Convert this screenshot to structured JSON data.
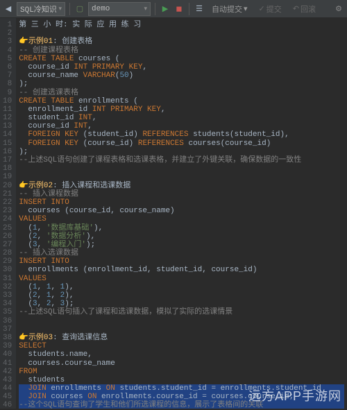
{
  "toolbar": {
    "left_dropdown": "SQL冷知识",
    "schema_dropdown": "demo",
    "autocommit_label": "自动提交",
    "submit_label": "提交",
    "rollback_label": "回滚"
  },
  "watermark": "远方APP手游网",
  "code_lines": [
    {
      "n": 1,
      "html": "第 三 小 时: 实 际 应 用 练 习"
    },
    {
      "n": 2,
      "html": ""
    },
    {
      "n": 3,
      "html": "<span class='c-emoji'>👉示例01</span>: 创建表格"
    },
    {
      "n": 4,
      "html": "<span class='c-comment'>-- 创建课程表格</span>"
    },
    {
      "n": 5,
      "html": "<span class='c-kw'>CREATE TABLE</span> courses ("
    },
    {
      "n": 6,
      "html": "  course_id <span class='c-type'>INT PRIMARY KEY</span>,"
    },
    {
      "n": 7,
      "html": "  course_name <span class='c-type'>VARCHAR</span>(<span class='c-num'>50</span>)"
    },
    {
      "n": 8,
      "html": ");"
    },
    {
      "n": 9,
      "html": "<span class='c-comment'>-- 创建选课表格</span>"
    },
    {
      "n": 10,
      "html": "<span class='c-kw'>CREATE TABLE</span> enrollments ("
    },
    {
      "n": 11,
      "html": "  enrollment_id <span class='c-type'>INT PRIMARY KEY</span>,"
    },
    {
      "n": 12,
      "html": "  student_id <span class='c-type'>INT</span>,"
    },
    {
      "n": 13,
      "html": "  course_id <span class='c-type'>INT</span>,"
    },
    {
      "n": 14,
      "html": "  <span class='c-kw'>FOREIGN KEY</span> (student_id) <span class='c-kw'>REFERENCES</span> students(student_id),"
    },
    {
      "n": 15,
      "html": "  <span class='c-kw'>FOREIGN KEY</span> (course_id) <span class='c-kw'>REFERENCES</span> courses(course_id)"
    },
    {
      "n": 16,
      "html": ");"
    },
    {
      "n": 17,
      "html": "<span class='c-comment'>--上述SQL语句创建了课程表格和选课表格，并建立了外键关联，确保数据的一致性</span>"
    },
    {
      "n": 18,
      "html": ""
    },
    {
      "n": 19,
      "html": ""
    },
    {
      "n": 20,
      "html": "<span class='c-emoji'>👉示例02</span>: 插入课程和选课数据"
    },
    {
      "n": 21,
      "html": "<span class='c-comment'>-- 插入课程数据</span>"
    },
    {
      "n": 22,
      "html": "<span class='c-kw'>INSERT INTO</span>"
    },
    {
      "n": 23,
      "html": "  courses (course_id, course_name)"
    },
    {
      "n": 24,
      "html": "<span class='c-kw'>VALUES</span>"
    },
    {
      "n": 25,
      "html": "  (<span class='c-num'>1</span>, <span class='c-str'>'数据库基础'</span>),"
    },
    {
      "n": 26,
      "html": "  (<span class='c-num'>2</span>, <span class='c-str'>'数据分析'</span>),"
    },
    {
      "n": 27,
      "html": "  (<span class='c-num'>3</span>, <span class='c-str'>'编程入门'</span>);"
    },
    {
      "n": 28,
      "html": "<span class='c-comment'>-- 插入选课数据</span>"
    },
    {
      "n": 29,
      "html": "<span class='c-kw'>INSERT INTO</span>"
    },
    {
      "n": 30,
      "html": "  enrollments (enrollment_id, student_id, course_id)"
    },
    {
      "n": 31,
      "html": "<span class='c-kw'>VALUES</span>"
    },
    {
      "n": 32,
      "html": "  (<span class='c-num'>1</span>, <span class='c-num'>1</span>, <span class='c-num'>1</span>),"
    },
    {
      "n": 33,
      "html": "  (<span class='c-num'>2</span>, <span class='c-num'>1</span>, <span class='c-num'>2</span>),"
    },
    {
      "n": 34,
      "html": "  (<span class='c-num'>3</span>, <span class='c-num'>2</span>, <span class='c-num'>3</span>);"
    },
    {
      "n": 35,
      "html": "<span class='c-comment'>--上述SQL语句插入了课程和选课数据，模拟了实际的选课情景</span>"
    },
    {
      "n": 36,
      "html": ""
    },
    {
      "n": 37,
      "html": ""
    },
    {
      "n": 38,
      "html": "<span class='c-emoji'>👉示例03</span>: 查询选课信息"
    },
    {
      "n": 39,
      "html": "<span class='c-kw'>SELECT</span>"
    },
    {
      "n": 40,
      "html": "  students.name,"
    },
    {
      "n": 41,
      "html": "  courses.course_name"
    },
    {
      "n": 42,
      "html": "<span class='c-kw'>FROM</span>"
    },
    {
      "n": 43,
      "html": "  students"
    },
    {
      "n": 44,
      "html": "  <span class='c-kw'>JOIN</span> enrollments <span class='c-kw'>ON</span> students.student_id = enrollments.student_id",
      "sel": true
    },
    {
      "n": 45,
      "html": "  <span class='c-kw'>JOIN</span> courses <span class='c-kw'>ON</span> enrollments.course_id = courses.course_id;",
      "sel": true
    },
    {
      "n": 46,
      "html": "<span class='c-comment'>--这个SQL语句查询了学生和他们所选课程的信息，展示了表格间的关联</span>",
      "sel": true
    }
  ]
}
